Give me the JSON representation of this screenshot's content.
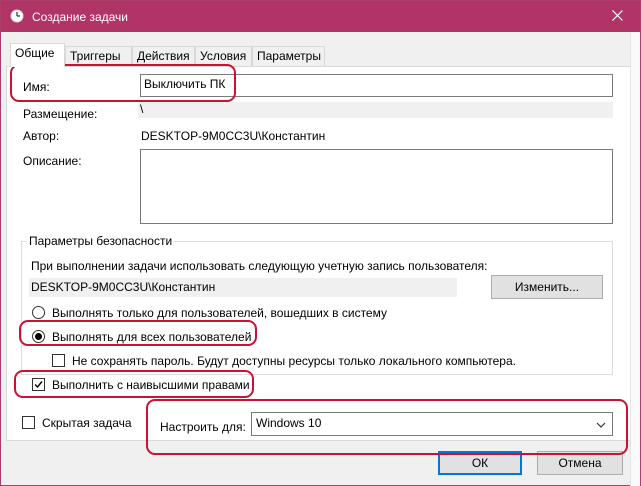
{
  "window": {
    "title": "Создание задачи",
    "title_bar_color": "#b03566"
  },
  "tabs": [
    {
      "label": "Общие",
      "active": true
    },
    {
      "label": "Триггеры",
      "active": false
    },
    {
      "label": "Действия",
      "active": false
    },
    {
      "label": "Условия",
      "active": false
    },
    {
      "label": "Параметры",
      "active": false
    }
  ],
  "general": {
    "name_label": "Имя:",
    "name_value": "Выключить ПК",
    "location_label": "Размещение:",
    "location_value": "\\",
    "author_label": "Автор:",
    "author_value": "DESKTOP-9M0CC3U\\Константин",
    "description_label": "Описание:",
    "description_value": ""
  },
  "security": {
    "group_title": "Параметры безопасности",
    "account_prompt": "При выполнении задачи использовать следующую учетную запись пользователя:",
    "account_value": "DESKTOP-9M0CC3U\\Константин",
    "change_button": "Изменить...",
    "radio_logged_on": "Выполнять только для пользователей, вошедших в систему",
    "radio_all_users": "Выполнять для всех пользователей",
    "selected_radio": "all_users",
    "no_store_password": "Не сохранять пароль. Будут доступны ресурсы только локального компьютера.",
    "highest_privileges": "Выполнить с наивысшими правами",
    "highest_privileges_checked": true
  },
  "footer": {
    "hidden_label": "Скрытая задача",
    "hidden_checked": false,
    "configure_label": "Настроить для:",
    "configure_value": "Windows 10",
    "ok_button": "ОК",
    "cancel_button": "Отмена"
  },
  "icons": {
    "title": "clock-icon",
    "close": "close-icon",
    "dropdown": "chevron-down-icon"
  },
  "accent_color": "#0078d7",
  "highlight_color": "#cc1133"
}
